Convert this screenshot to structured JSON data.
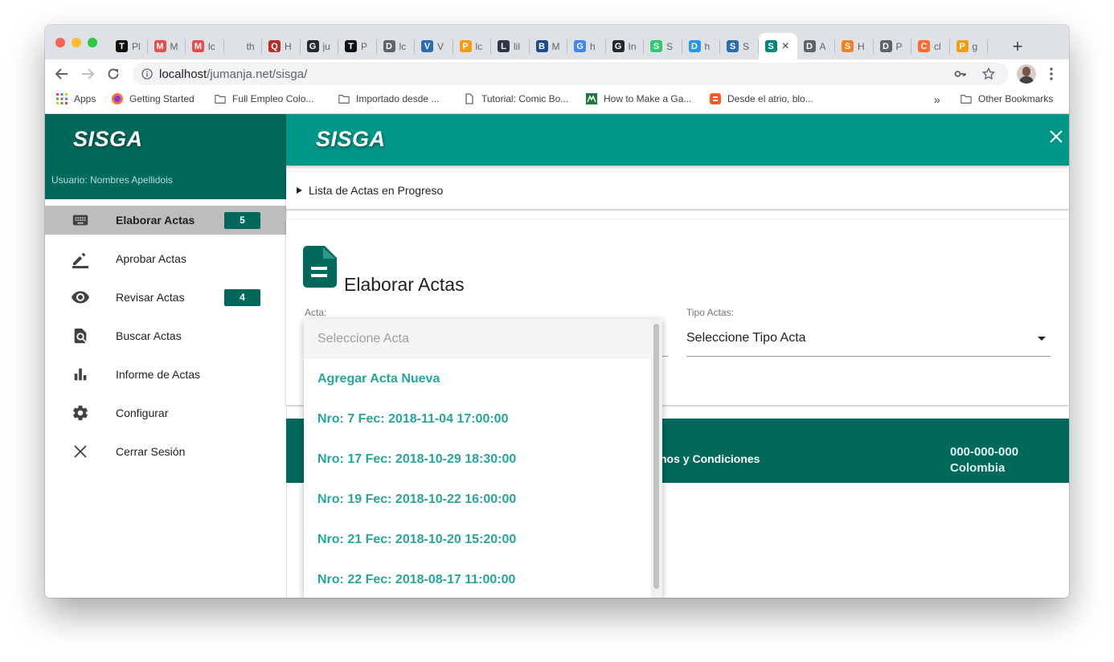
{
  "browser": {
    "tabs": [
      {
        "label": "Pl",
        "icon": "T",
        "color": "#111111"
      },
      {
        "label": "M",
        "icon": "M",
        "color": "#e94a4a"
      },
      {
        "label": "lc",
        "icon": "M",
        "color": "#e94a4a"
      },
      {
        "label": "th",
        "icon": "",
        "color": "#dee1e6"
      },
      {
        "label": "H",
        "icon": "Q",
        "color": "#b92b27"
      },
      {
        "label": "ju",
        "icon": "G",
        "color": "#24292e"
      },
      {
        "label": "P",
        "icon": "T",
        "color": "#111111"
      },
      {
        "label": "lc",
        "icon": "D",
        "color": "#5f6368"
      },
      {
        "label": "V",
        "icon": "V",
        "color": "#2b6cb0"
      },
      {
        "label": "lc",
        "icon": "P",
        "color": "#f39c12"
      },
      {
        "label": "lil",
        "icon": "L",
        "color": "#2d3748"
      },
      {
        "label": "M",
        "icon": "B",
        "color": "#1e4b8f"
      },
      {
        "label": "h",
        "icon": "G",
        "color": "#4285f4"
      },
      {
        "label": "In",
        "icon": "G",
        "color": "#24292e"
      },
      {
        "label": "S",
        "icon": "S",
        "color": "#2ecc71"
      },
      {
        "label": "h",
        "icon": "D",
        "color": "#2496ed"
      },
      {
        "label": "S",
        "icon": "S",
        "color": "#2b6cb0"
      },
      {
        "label": "×",
        "icon": "S",
        "color": "#00897b",
        "active": true
      },
      {
        "label": "A",
        "icon": "D",
        "color": "#5f6368"
      },
      {
        "label": "H",
        "icon": "S",
        "color": "#f48024"
      },
      {
        "label": "P",
        "icon": "D",
        "color": "#5f6368"
      },
      {
        "label": "cl",
        "icon": "C",
        "color": "#ff6c2c"
      },
      {
        "label": "g",
        "icon": "P",
        "color": "#f39c12"
      }
    ],
    "url_host": "localhost",
    "url_path": "/jumanja.net/sisga/",
    "bookmarks": {
      "apps": "Apps",
      "getting_started": "Getting Started",
      "full_empleo": "Full Empleo Colo...",
      "importado": "Importado desde ...",
      "tutorial": "Tutorial: Comic Bo...",
      "how_to": "How to Make a Ga...",
      "desde_atrio": "Desde el atrio, blo...",
      "more": "»",
      "other": "Other Bookmarks"
    }
  },
  "app": {
    "brand": "SISGA",
    "user": "Usuario: Nombres Apellidois",
    "menu": [
      {
        "label": "Elaborar Actas",
        "icon": "keyboard-icon",
        "badge": "5",
        "active": true
      },
      {
        "label": "Aprobar Actas",
        "icon": "edit-icon"
      },
      {
        "label": "Revisar Actas",
        "icon": "eye-icon",
        "badge": "4"
      },
      {
        "label": "Buscar Actas",
        "icon": "find-in-page-icon"
      },
      {
        "label": "Informe de Actas",
        "icon": "bar-chart-icon"
      },
      {
        "label": "Configurar",
        "icon": "gear-icon"
      },
      {
        "label": "Cerrar Sesión",
        "icon": "close-icon"
      }
    ],
    "progress_summary": "Lista de Actas en Progreso",
    "form": {
      "title": "Elaborar Actas",
      "acta_label": "Acta:",
      "tipo_label": "Tipo Actas:",
      "tipo_value": "Seleccione Tipo Acta"
    },
    "dropdown": {
      "placeholder": "Seleccione Acta",
      "options": [
        "Agregar Acta Nueva",
        "Nro: 7 Fec: 2018-11-04 17:00:00",
        "Nro: 17 Fec: 2018-10-29 18:30:00",
        "Nro: 19 Fec: 2018-10-22 16:00:00",
        "Nro: 21 Fec: 2018-10-20 15:20:00",
        "Nro: 22 Fec: 2018-08-17 11:00:00"
      ]
    },
    "footer": {
      "terms": "nos y Condiciones",
      "phone": "000-000-000",
      "country": "Colombia"
    },
    "colors": {
      "primary": "#009688",
      "dark": "#00695c",
      "option": "#26a69a"
    }
  }
}
